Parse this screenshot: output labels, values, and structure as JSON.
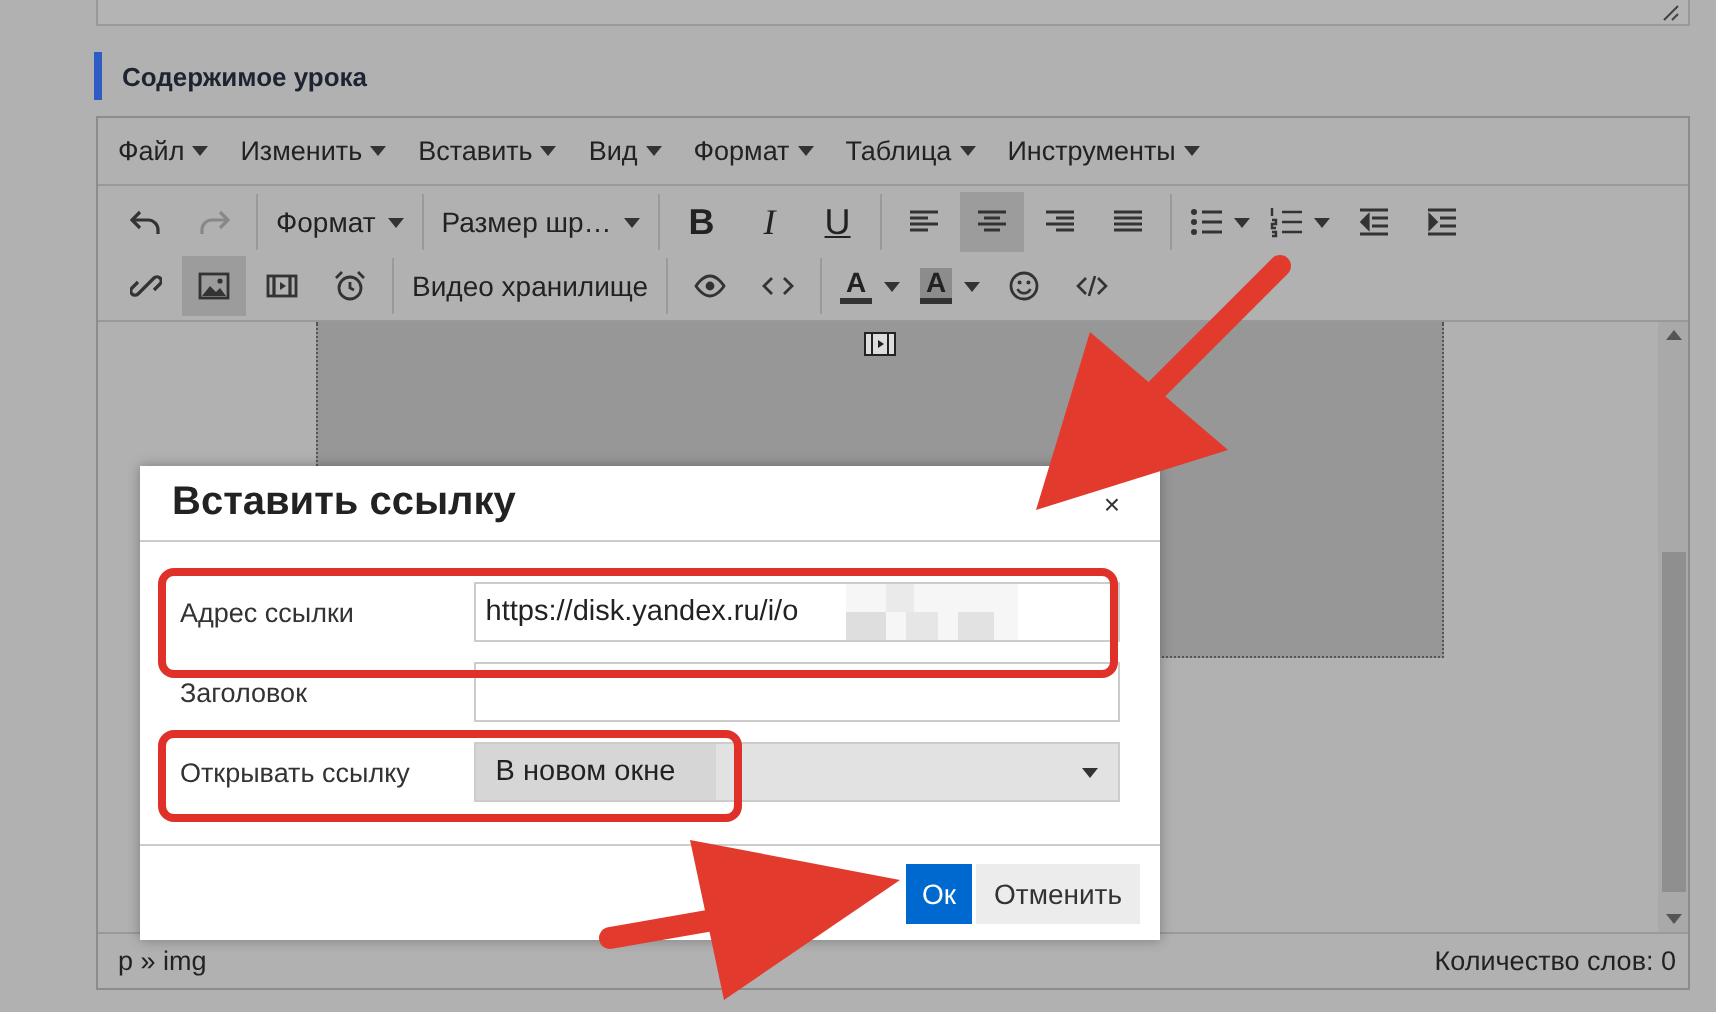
{
  "section_title": "Содержимое урока",
  "menu": [
    {
      "label": "Файл"
    },
    {
      "label": "Изменить"
    },
    {
      "label": "Вставить"
    },
    {
      "label": "Вид"
    },
    {
      "label": "Формат"
    },
    {
      "label": "Таблица"
    },
    {
      "label": "Инструменты"
    }
  ],
  "toolbar_rows": [
    {
      "groups": [
        [
          {
            "kind": "undo",
            "selected": false,
            "disabled": false
          },
          {
            "kind": "redo",
            "selected": false,
            "disabled": true
          }
        ],
        [
          {
            "kind": "dropdown",
            "label": "Формат",
            "selected": false,
            "disabled": false
          }
        ],
        [
          {
            "kind": "dropdown",
            "label": "Размер шр…",
            "selected": false,
            "disabled": false
          }
        ],
        [
          {
            "kind": "bold",
            "label": "B",
            "selected": false,
            "disabled": false
          },
          {
            "kind": "italic",
            "label": "I",
            "selected": false,
            "disabled": false
          },
          {
            "kind": "underline",
            "label": "U",
            "selected": false,
            "disabled": false
          }
        ],
        [
          {
            "kind": "alignleft",
            "selected": false,
            "disabled": false
          },
          {
            "kind": "aligncenter",
            "selected": true,
            "disabled": false
          },
          {
            "kind": "alignright",
            "selected": false,
            "disabled": false
          },
          {
            "kind": "alignjustify",
            "selected": false,
            "disabled": false
          }
        ],
        [
          {
            "kind": "bullist",
            "selected": false,
            "disabled": false
          },
          {
            "kind": "numlist",
            "selected": false,
            "disabled": false
          },
          {
            "kind": "outdent",
            "selected": false,
            "disabled": false
          },
          {
            "kind": "indent",
            "selected": false,
            "disabled": false
          }
        ]
      ]
    },
    {
      "groups": [
        [
          {
            "kind": "link",
            "selected": false,
            "disabled": false
          },
          {
            "kind": "image",
            "selected": true,
            "disabled": false
          },
          {
            "kind": "media",
            "selected": false,
            "disabled": false
          },
          {
            "kind": "alarm",
            "selected": false,
            "disabled": false
          }
        ],
        [
          {
            "kind": "text",
            "label": "Видео хранилище",
            "selected": false,
            "disabled": false
          }
        ],
        [
          {
            "kind": "preview",
            "selected": false,
            "disabled": false
          },
          {
            "kind": "code",
            "selected": false,
            "disabled": false
          }
        ],
        [
          {
            "kind": "forecolor",
            "label": "A",
            "selected": false,
            "disabled": false
          },
          {
            "kind": "backcolor",
            "label": "A",
            "selected": false,
            "disabled": false
          },
          {
            "kind": "emoticons",
            "selected": false,
            "disabled": false
          },
          {
            "kind": "source",
            "selected": false,
            "disabled": false
          }
        ]
      ]
    }
  ],
  "status_bar": {
    "path": "p » img",
    "word_count": "Количество слов: 0"
  },
  "dialog": {
    "title": "Вставить ссылку",
    "close": "×",
    "fields": [
      {
        "kind": "input",
        "label": "Адрес ссылки",
        "value": "https://disk.yandex.ru/i/o",
        "redacted": true
      },
      {
        "kind": "input",
        "label": "Заголовок",
        "redacted": false
      },
      {
        "kind": "select",
        "label": "Открывать ссылку",
        "value": "В новом окне",
        "redacted": false
      }
    ],
    "buttons": [
      {
        "label": "Ок",
        "kind": "primary"
      },
      {
        "label": "Отменить",
        "kind": "secondary"
      }
    ]
  }
}
